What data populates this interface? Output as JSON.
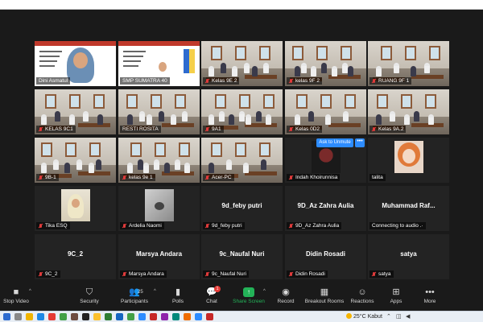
{
  "gallery": {
    "participants": [
      {
        "name": "Dini Asmatul",
        "kind": "video-slide-speaker",
        "muted": false,
        "active": true
      },
      {
        "name": "SMP SUMATRA 40",
        "kind": "video-slide",
        "muted": false
      },
      {
        "name": "Kelas 9E 2",
        "kind": "video-classroom",
        "muted": true
      },
      {
        "name": "kelas 9F 2",
        "kind": "video-classroom",
        "muted": true
      },
      {
        "name": "RUANG 9F 1",
        "kind": "video-classroom",
        "muted": true
      },
      {
        "name": "KELAS 9C1",
        "kind": "video-classroom",
        "muted": true
      },
      {
        "name": "RESTI ROSITA",
        "kind": "video-classroom",
        "muted": false
      },
      {
        "name": "9A1",
        "kind": "video-classroom",
        "muted": true
      },
      {
        "name": "Kelas 0D2",
        "kind": "video-classroom",
        "muted": true
      },
      {
        "name": "Kelas 9A.2",
        "kind": "video-classroom",
        "muted": true
      },
      {
        "name": "9B-1",
        "kind": "video-classroom",
        "muted": true
      },
      {
        "name": "kelas 9e 1",
        "kind": "video-classroom",
        "muted": true
      },
      {
        "name": "Acer-PC",
        "kind": "video-classroom",
        "muted": true
      },
      {
        "name": "Indah Khoirunnisa",
        "kind": "avatar-dark",
        "muted": true
      },
      {
        "name": "talita",
        "kind": "avatar-anime",
        "muted": false
      },
      {
        "name": "Tika ESQ",
        "kind": "avatar-photo",
        "muted": true
      },
      {
        "name": "Ardelia Naomi",
        "kind": "avatar-bw",
        "muted": true
      },
      {
        "name": "9d_feby putri",
        "kind": "name-only",
        "muted": true
      },
      {
        "name": "9D_Az Zahra Aulia",
        "kind": "name-only",
        "muted": true
      },
      {
        "name": "Muhammad  Raf...",
        "kind": "name-only",
        "muted": false,
        "status": "Connecting to audio"
      },
      {
        "name": "9C_2",
        "kind": "name-only",
        "muted": true
      },
      {
        "name": "Marsya Andara",
        "kind": "name-only",
        "muted": true
      },
      {
        "name": "9c_Naufal Nuri",
        "kind": "name-only",
        "muted": true
      },
      {
        "name": "Didin Rosadi",
        "kind": "name-only",
        "muted": true
      },
      {
        "name": "satya",
        "kind": "name-only",
        "muted": true
      }
    ],
    "ask_to_unmute": "Ask to Unmute",
    "more_symbol": "•••"
  },
  "toolbar": {
    "stop_video": "Stop Video",
    "security": "Security",
    "participants": "Participants",
    "participant_count": "25",
    "polls": "Polls",
    "chat": "Chat",
    "chat_badge": "1",
    "share_screen": "Share Screen",
    "record": "Record",
    "breakout_rooms": "Breakout Rooms",
    "reactions": "Reactions",
    "apps": "Apps",
    "more": "More"
  },
  "taskbar": {
    "temperature": "25°C",
    "weather": "Kabut"
  },
  "colors": {
    "zoom_blue": "#2d8cff",
    "share_green": "#23b358",
    "active_speaker": "#b8e05a",
    "muted_red": "#e03b3b"
  }
}
